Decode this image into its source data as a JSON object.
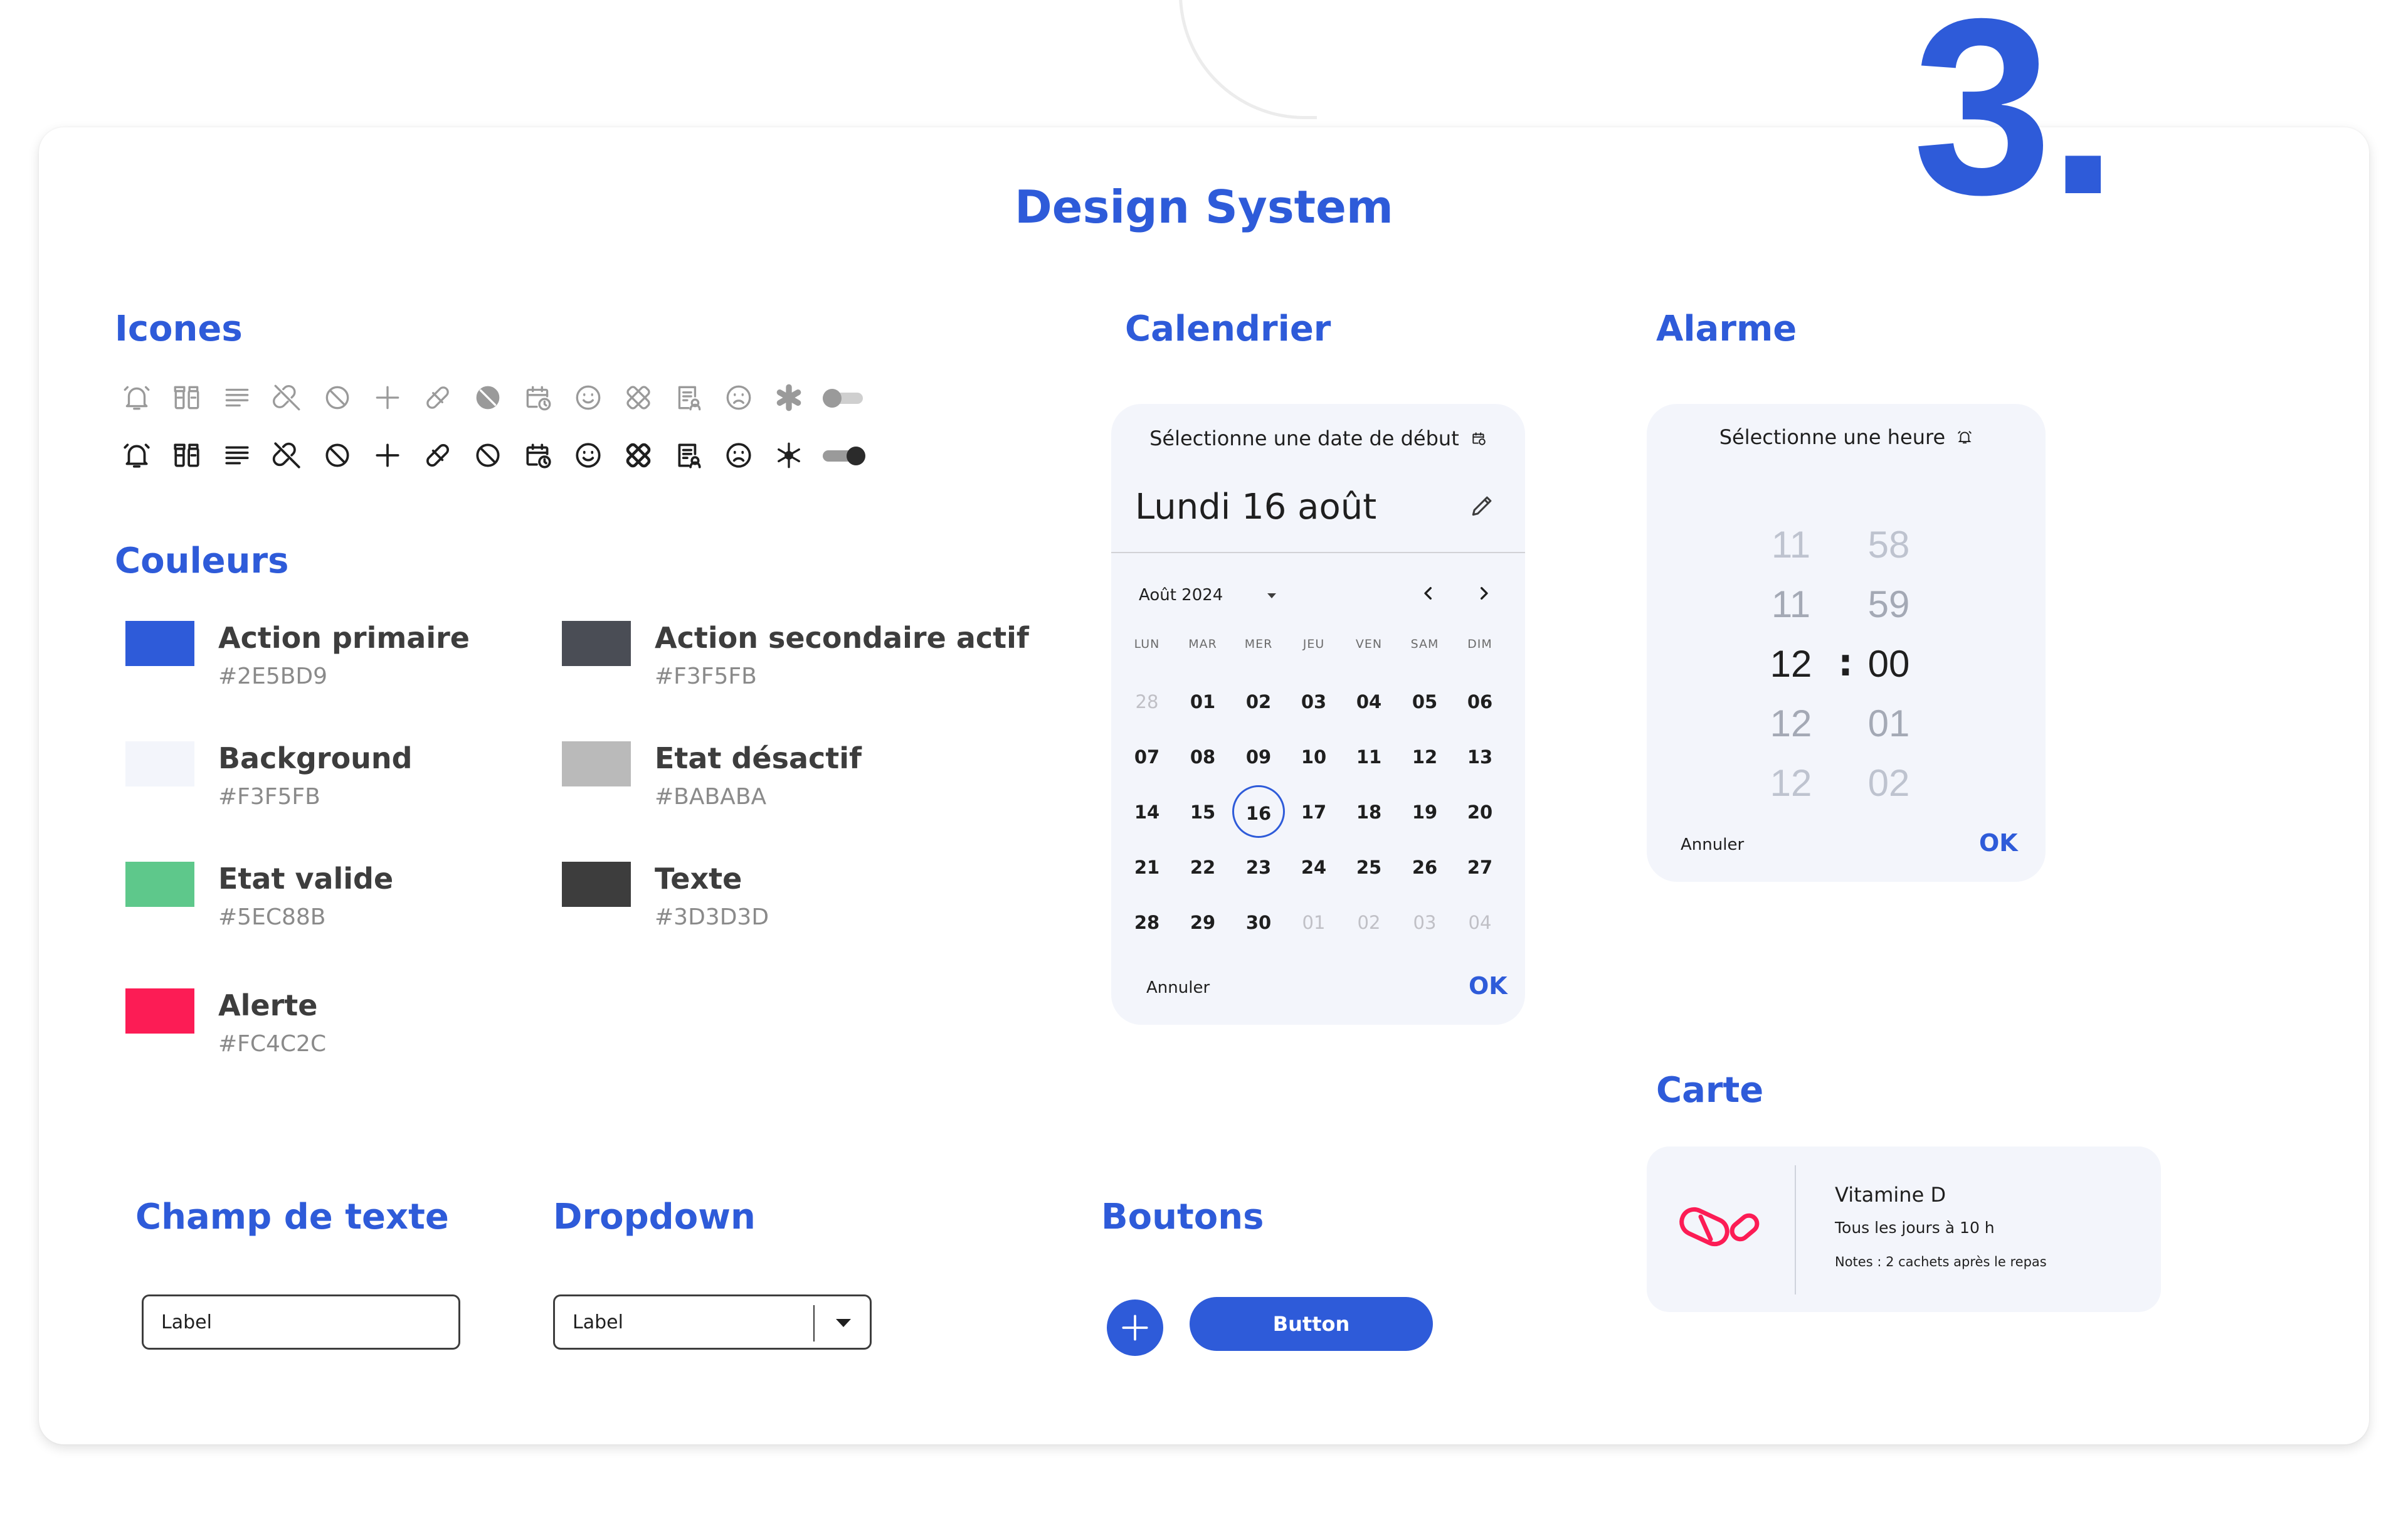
{
  "number": "3.",
  "title": "Design System",
  "sections": {
    "icons": "Icones",
    "colors": "Couleurs",
    "calendar": "Calendrier",
    "alarm": "Alarme",
    "card": "Carte",
    "text_field": "Champ de texte",
    "dropdown": "Dropdown",
    "buttons": "Boutons"
  },
  "icons": [
    "bell-icon",
    "pill-bottle-icon",
    "list-icon",
    "pill-off-icon",
    "ban-icon",
    "plus-icon",
    "pill-icon",
    "pill-disabled-icon",
    "calendar-clock-icon",
    "smile-icon",
    "bandage-icon",
    "prescription-icon",
    "frown-icon",
    "asterisk-icon",
    "toggle"
  ],
  "colors": [
    {
      "name": "Action primaire",
      "hex": "#2E5BD9",
      "swatch": "#2E5BD9"
    },
    {
      "name": "Action secondaire actif",
      "hex": "#F3F5FB",
      "swatch": "#4A4D55"
    },
    {
      "name": "Background",
      "hex": "#F3F5FB",
      "swatch": "#F3F5FB"
    },
    {
      "name": "Etat désactif",
      "hex": "#BABABA",
      "swatch": "#BABABA"
    },
    {
      "name": "Etat valide",
      "hex": "#5EC88B",
      "swatch": "#5EC88B"
    },
    {
      "name": "Texte",
      "hex": "#3D3D3D",
      "swatch": "#3D3D3D"
    },
    {
      "name": "Alerte",
      "hex": "#FC4C2C",
      "swatch": "#FC1C55"
    }
  ],
  "calendar": {
    "header": "Sélectionne une date de début",
    "date": "Lundi 16 août",
    "month": "Août 2024",
    "weekdays": [
      "LUN",
      "MAR",
      "MER",
      "JEU",
      "VEN",
      "SAM",
      "DIM"
    ],
    "days": [
      [
        "28",
        "01",
        "02",
        "03",
        "04",
        "05",
        "06"
      ],
      [
        "07",
        "08",
        "09",
        "10",
        "11",
        "12",
        "13"
      ],
      [
        "14",
        "15",
        "16",
        "17",
        "18",
        "19",
        "20"
      ],
      [
        "21",
        "22",
        "23",
        "24",
        "25",
        "26",
        "27"
      ],
      [
        "28",
        "29",
        "30",
        "01",
        "02",
        "03",
        "04"
      ]
    ],
    "selected_day": "16",
    "cancel": "Annuler",
    "ok": "OK"
  },
  "alarm": {
    "header": "Sélectionne une heure",
    "hours": [
      "11",
      "11",
      "12",
      "12",
      "12"
    ],
    "minutes": [
      "58",
      "59",
      "00",
      "01",
      "02"
    ],
    "separator": ":",
    "cancel": "Annuler",
    "ok": "OK"
  },
  "text_field": {
    "label": "Label"
  },
  "dropdown": {
    "label": "Label"
  },
  "buttons": {
    "primary": "Button"
  },
  "card": {
    "title": "Vitamine D",
    "schedule": "Tous les jours à 10 h",
    "notes": "Notes : 2 cachets après le repas"
  }
}
